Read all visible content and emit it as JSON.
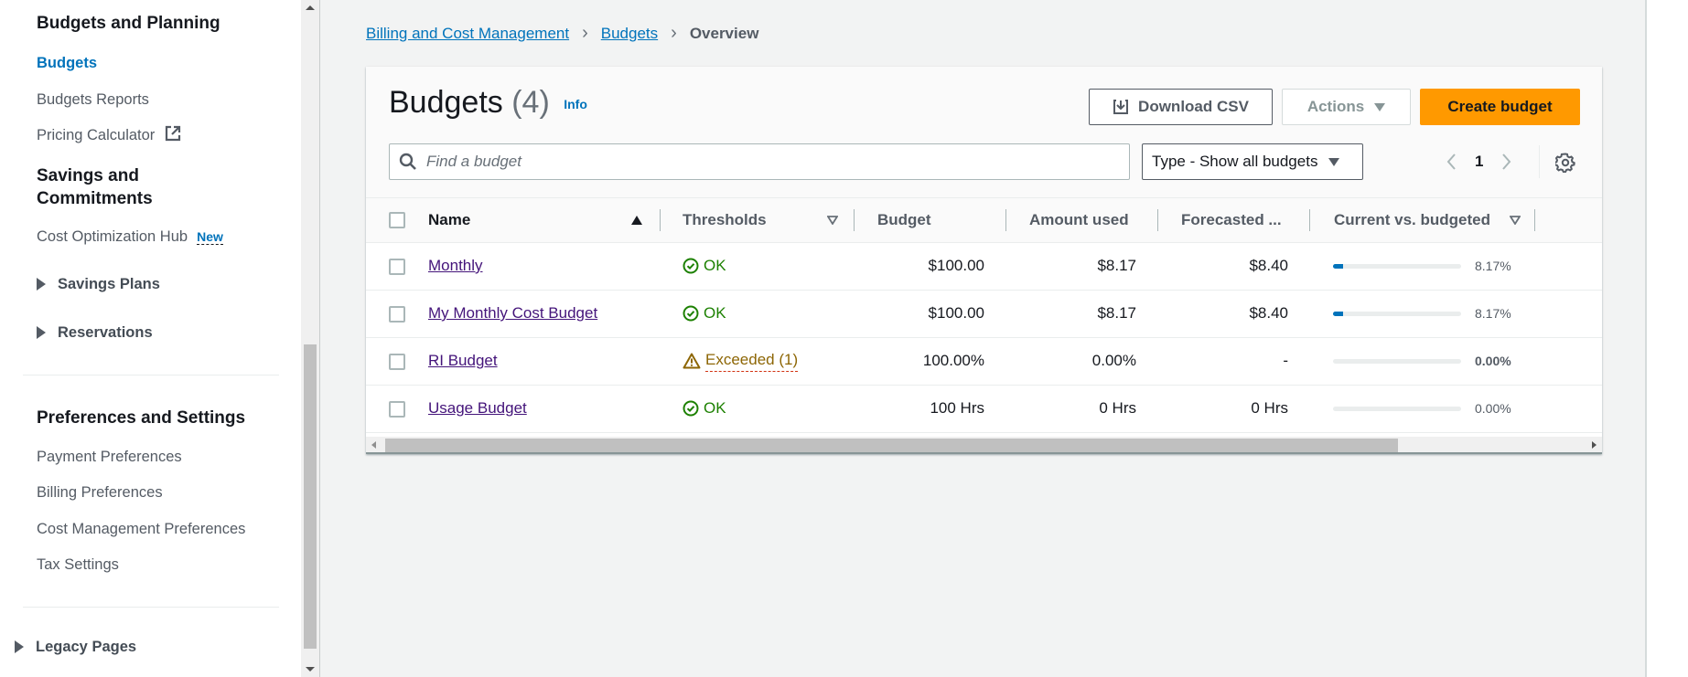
{
  "sidebar": {
    "sections": [
      {
        "heading": "Budgets and Planning"
      },
      {
        "heading": "Savings and Commitments"
      },
      {
        "heading": "Preferences and Settings"
      }
    ],
    "budgets_planning": {
      "items": [
        {
          "label": "Budgets",
          "active": true
        },
        {
          "label": "Budgets Reports"
        },
        {
          "label": "Pricing Calculator",
          "icon": "external-link-icon"
        }
      ]
    },
    "savings": {
      "cost_hub": {
        "label": "Cost Optimization Hub",
        "badge": "New"
      },
      "savings_plans": "Savings Plans",
      "reservations": "Reservations"
    },
    "preferences": {
      "items": [
        {
          "label": "Payment Preferences"
        },
        {
          "label": "Billing Preferences"
        },
        {
          "label": "Cost Management Preferences"
        },
        {
          "label": "Tax Settings"
        }
      ]
    },
    "legacy": "Legacy Pages"
  },
  "breadcrumb": {
    "items": [
      {
        "label": "Billing and Cost Management"
      },
      {
        "label": "Budgets"
      }
    ],
    "current": "Overview"
  },
  "header": {
    "title": "Budgets",
    "count": "(4)",
    "info": "Info",
    "download_label": "Download CSV",
    "actions_label": "Actions",
    "create_label": "Create budget"
  },
  "filter": {
    "search_placeholder": "Find a budget",
    "type_select": "Type - Show all budgets",
    "page": "1"
  },
  "table": {
    "columns": [
      "Name",
      "Thresholds",
      "Budget",
      "Amount used",
      "Forecasted ...",
      "Current vs. budgeted"
    ],
    "rows": [
      {
        "name": "Monthly",
        "threshold": "OK",
        "threshold_status": "ok",
        "budget": "$100.00",
        "amount_used": "$8.17",
        "forecasted": "$8.40",
        "current_pct": "8.17%",
        "current_fraction": 0.0817,
        "pct_bold": false
      },
      {
        "name": "My Monthly Cost Budget",
        "threshold": "OK",
        "threshold_status": "ok",
        "budget": "$100.00",
        "amount_used": "$8.17",
        "forecasted": "$8.40",
        "current_pct": "8.17%",
        "current_fraction": 0.0817,
        "pct_bold": false
      },
      {
        "name": "RI Budget",
        "threshold": "Exceeded (1)",
        "threshold_status": "warning",
        "budget": "100.00%",
        "amount_used": "0.00%",
        "forecasted": "-",
        "current_pct": "0.00%",
        "current_fraction": 0,
        "pct_bold": true
      },
      {
        "name": "Usage Budget",
        "threshold": "OK",
        "threshold_status": "ok",
        "budget": "100 Hrs",
        "amount_used": "0 Hrs",
        "forecasted": "0 Hrs",
        "current_pct": "0.00%",
        "current_fraction": 0,
        "pct_bold": false
      }
    ]
  },
  "colors": {
    "link": "#0073bb",
    "visited_link": "#44147a",
    "primary_button": "#ff9900",
    "ok": "#1d8102",
    "warning": "#8d6605"
  }
}
